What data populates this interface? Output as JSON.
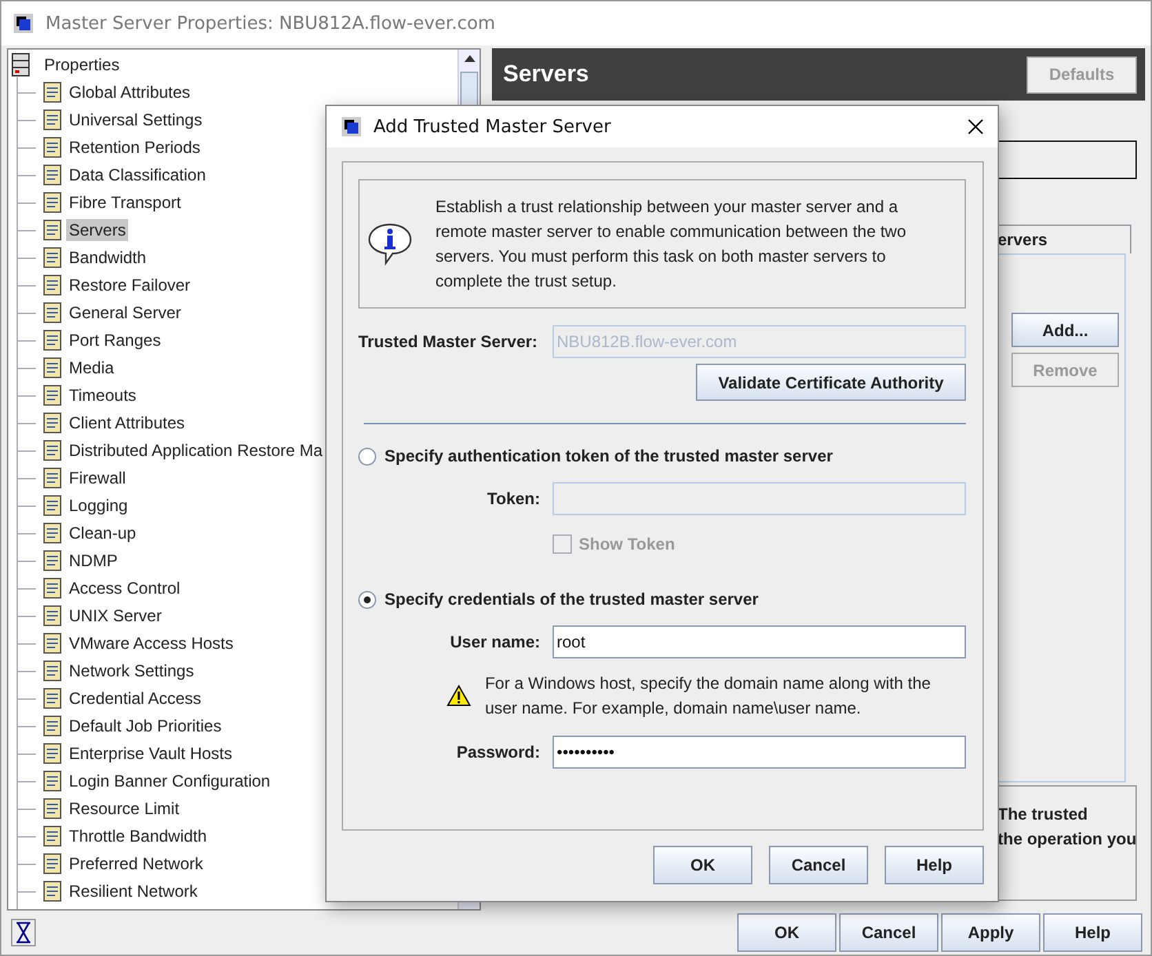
{
  "window": {
    "title": "Master Server Properties: NBU812A.flow-ever.com"
  },
  "tree": {
    "root": "Properties",
    "items": [
      {
        "label": "Global Attributes",
        "selected": false
      },
      {
        "label": "Universal Settings",
        "selected": false
      },
      {
        "label": "Retention Periods",
        "selected": false
      },
      {
        "label": "Data Classification",
        "selected": false
      },
      {
        "label": "Fibre Transport",
        "selected": false
      },
      {
        "label": "Servers",
        "selected": true
      },
      {
        "label": "Bandwidth",
        "selected": false
      },
      {
        "label": "Restore Failover",
        "selected": false
      },
      {
        "label": "General Server",
        "selected": false
      },
      {
        "label": "Port Ranges",
        "selected": false
      },
      {
        "label": "Media",
        "selected": false
      },
      {
        "label": "Timeouts",
        "selected": false
      },
      {
        "label": "Client Attributes",
        "selected": false
      },
      {
        "label": "Distributed Application Restore Ma",
        "selected": false
      },
      {
        "label": "Firewall",
        "selected": false
      },
      {
        "label": "Logging",
        "selected": false
      },
      {
        "label": "Clean-up",
        "selected": false
      },
      {
        "label": "NDMP",
        "selected": false
      },
      {
        "label": "Access Control",
        "selected": false
      },
      {
        "label": "UNIX Server",
        "selected": false
      },
      {
        "label": "VMware Access Hosts",
        "selected": false
      },
      {
        "label": "Network Settings",
        "selected": false
      },
      {
        "label": "Credential Access",
        "selected": false
      },
      {
        "label": "Default Job Priorities",
        "selected": false
      },
      {
        "label": "Enterprise Vault Hosts",
        "selected": false
      },
      {
        "label": "Login Banner Configuration",
        "selected": false
      },
      {
        "label": "Resource Limit",
        "selected": false
      },
      {
        "label": "Throttle Bandwidth",
        "selected": false
      },
      {
        "label": "Preferred Network",
        "selected": false
      },
      {
        "label": "Resilient Network",
        "selected": false
      }
    ]
  },
  "panel": {
    "title": "Servers",
    "defaults_button": {
      "label": "Defaults",
      "disabled": true
    },
    "tab_label": "ervers",
    "add_button": {
      "label": "Add...",
      "disabled": false
    },
    "remove_button": {
      "label": "Remove",
      "disabled": true
    },
    "note_lines": [
      "The trusted",
      "the operation you"
    ]
  },
  "dialog": {
    "title": "Add Trusted Master Server",
    "info": "Establish a trust relationship between your master server and a remote master server to enable communication between the two servers. You must perform this task on both master servers to complete the trust setup.",
    "trusted_server": {
      "label": "Trusted Master Server:",
      "value": "NBU812B.flow-ever.com",
      "disabled": true
    },
    "validate_button": "Validate Certificate Authority",
    "options": [
      {
        "label": "Specify authentication token of the trusted master server",
        "selected": false
      },
      {
        "label": "Specify credentials of the trusted master server",
        "selected": true
      }
    ],
    "token": {
      "label": "Token:",
      "disabled": true
    },
    "show_token": {
      "label": "Show Token",
      "checked": false,
      "disabled": true
    },
    "user_name": {
      "label": "User name:",
      "value": "root"
    },
    "warning": "For a Windows host, specify the domain name along with the user name. For example, domain name\\user name.",
    "password": {
      "label": "Password:",
      "value": "••••••••••"
    },
    "buttons": [
      "OK",
      "Cancel",
      "Help"
    ]
  },
  "buttons": [
    "OK",
    "Cancel",
    "Apply",
    "Help"
  ]
}
